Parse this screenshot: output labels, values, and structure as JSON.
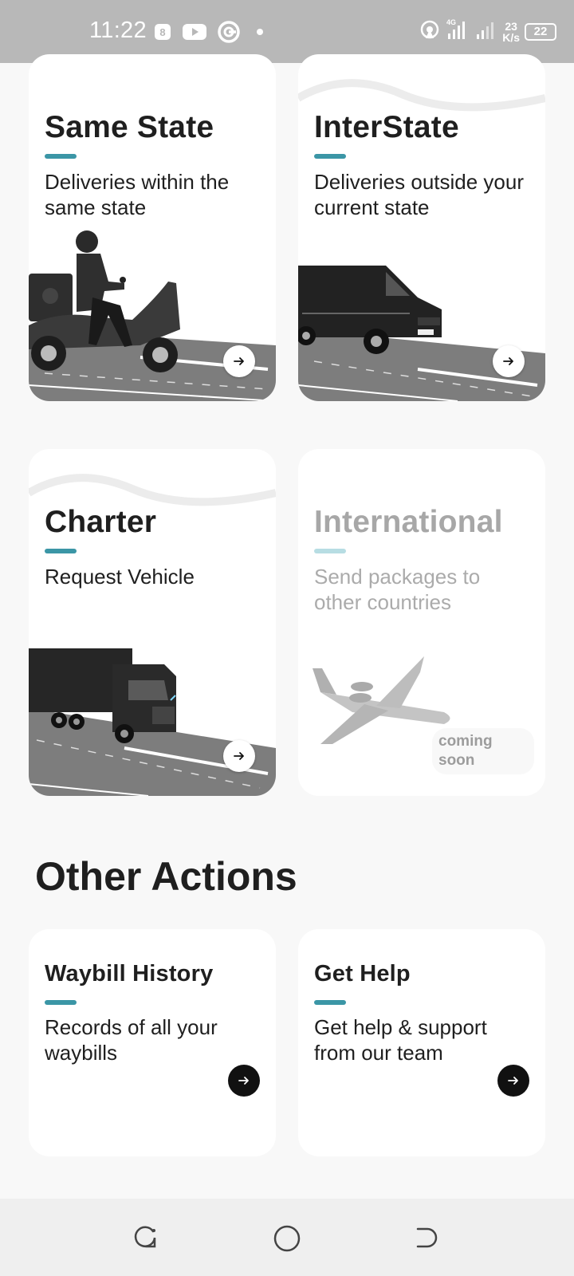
{
  "status_bar": {
    "time": "11:22",
    "network_type": "4G",
    "speed_value": "23",
    "speed_unit": "K/s",
    "battery": "22"
  },
  "delivery_options": [
    {
      "title": "Same State",
      "description": "Deliveries within the same state",
      "enabled": true,
      "illustration": "scooter-rider"
    },
    {
      "title": "InterState",
      "description": "Deliveries outside your current state",
      "enabled": true,
      "illustration": "van"
    },
    {
      "title": "Charter",
      "description": "Request Vehicle",
      "enabled": true,
      "illustration": "truck"
    },
    {
      "title": "International",
      "description": "Send packages to other countries",
      "enabled": false,
      "illustration": "airplane",
      "badge": "coming soon"
    }
  ],
  "other_actions": {
    "title": "Other Actions",
    "items": [
      {
        "title": "Waybill History",
        "description": "Records of all your waybills"
      },
      {
        "title": "Get Help",
        "description": "Get help & support from our team"
      }
    ]
  },
  "colors": {
    "accent": "#3b96a6",
    "accent_disabled": "#b7dde3",
    "road": "#7d7d7d"
  },
  "icons": [
    "arrow-right-icon",
    "recents-icon",
    "home-icon",
    "back-icon"
  ]
}
